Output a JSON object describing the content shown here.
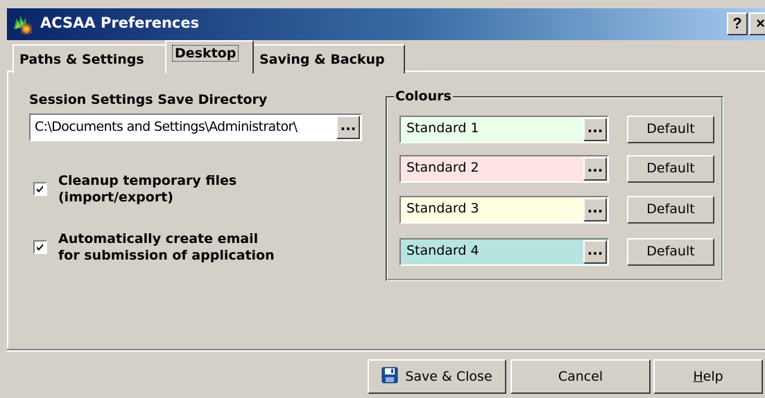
{
  "window": {
    "title": "ACSAA Preferences",
    "help_button": "?",
    "close_button": "×"
  },
  "tabs": [
    {
      "label": "Paths & Settings",
      "selected": false
    },
    {
      "label": "Desktop",
      "selected": true
    },
    {
      "label": "Saving & Backup",
      "selected": false
    }
  ],
  "desktop": {
    "session_label": "Session Settings Save Directory",
    "session_dir_value": "C:\\Documents and Settings\\Administrator\\",
    "browse_label": "...",
    "checkboxes": [
      {
        "line1": "Cleanup temporary files",
        "line2": "(import/export)",
        "checked": true
      },
      {
        "line1": "Automatically create email",
        "line2": "for submission of application",
        "checked": true
      }
    ],
    "colours": {
      "title": "Colours",
      "items": [
        {
          "label": "Standard 1",
          "color": "#eaffea",
          "browse": "...",
          "default_label": "Default"
        },
        {
          "label": "Standard 2",
          "color": "#ffe4e4",
          "browse": "...",
          "default_label": "Default"
        },
        {
          "label": "Standard 3",
          "color": "#ffffe4",
          "browse": "...",
          "default_label": "Default"
        },
        {
          "label": "Standard 4",
          "color": "#b8e4e0",
          "browse": "...",
          "default_label": "Default"
        }
      ]
    }
  },
  "footer": {
    "save_label": "Save & Close",
    "cancel_label": "Cancel",
    "help_label": "Help",
    "help_mnemonic": "H",
    "help_rest": "elp"
  }
}
